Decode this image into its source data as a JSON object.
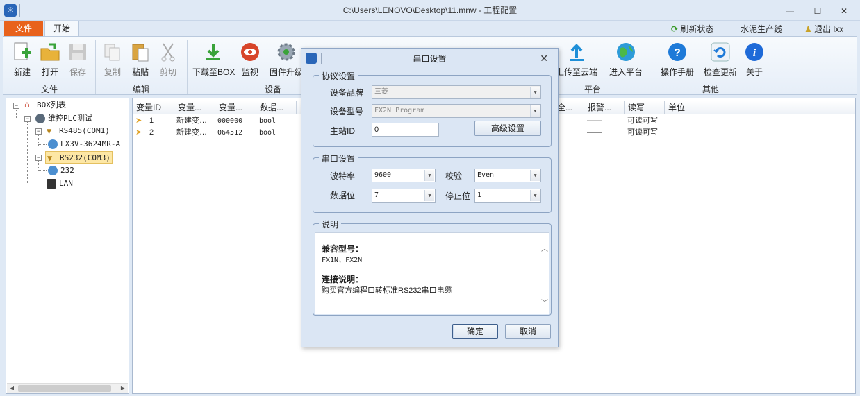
{
  "window": {
    "title": "C:\\Users\\LENOVO\\Desktop\\11.mnw - 工程配置",
    "min": "—",
    "max": "☐",
    "close": "✕"
  },
  "tabs": {
    "file": "文件",
    "start": "开始"
  },
  "topright": {
    "refresh": "刷新状态",
    "line": "水泥生产线",
    "logout": "退出 lxx"
  },
  "ribbon": {
    "file_group": "文件",
    "edit_group": "编辑",
    "device_group": "设备",
    "platform_group": "平台",
    "other_group": "其他",
    "new": "新建",
    "open": "打开",
    "save": "保存",
    "copy": "复制",
    "paste": "粘贴",
    "cut": "剪切",
    "download": "下载至BOX",
    "monitor": "监视",
    "firmware": "固件升级",
    "upload": "上传至云端",
    "enter_platform": "进入平台",
    "manual": "操作手册",
    "check_update": "检查更新",
    "about": "关于"
  },
  "tree": {
    "root": "BOX列表",
    "project": "维控PLC测试",
    "rs485": "RS485(COM1)",
    "device1": "LX3V-3624MR-A",
    "rs232": "RS232(COM3)",
    "device2": "232",
    "lan": "LAN"
  },
  "grid": {
    "headers": [
      "变量ID",
      "变量...",
      "变量...",
      "数据...",
      "",
      "全...",
      "报警...",
      "读写",
      "单位"
    ],
    "rows": [
      {
        "id": "1",
        "name": "新建变…",
        "addr": "000000",
        "type": "bool",
        "alarm": "——",
        "rw": "可读可写"
      },
      {
        "id": "2",
        "name": "新建变…",
        "addr": "064512",
        "type": "bool",
        "alarm": "——",
        "rw": "可读可写"
      }
    ]
  },
  "dialog": {
    "title": "串口设置",
    "protocol_legend": "协议设置",
    "brand_label": "设备品牌",
    "brand_value": "三菱",
    "model_label": "设备型号",
    "model_value": "FX2N_Program",
    "station_label": "主站ID",
    "station_value": "0",
    "advanced": "高级设置",
    "serial_legend": "串口设置",
    "baud_label": "波特率",
    "baud_value": "9600",
    "parity_label": "校验",
    "parity_value": "Even",
    "databits_label": "数据位",
    "databits_value": "7",
    "stopbits_label": "停止位",
    "stopbits_value": "1",
    "desc_legend": "说明",
    "compat_title": "兼容型号：",
    "compat_value": "FX1N、FX2N",
    "conn_title": "连接说明：",
    "conn_value": "购买官方编程口转标准RS232串口电缆",
    "ok": "确定",
    "cancel": "取消"
  },
  "colors": {
    "accent": "#2a66b8",
    "file_tab": "#e8621c",
    "selected": "#fde7a5"
  }
}
